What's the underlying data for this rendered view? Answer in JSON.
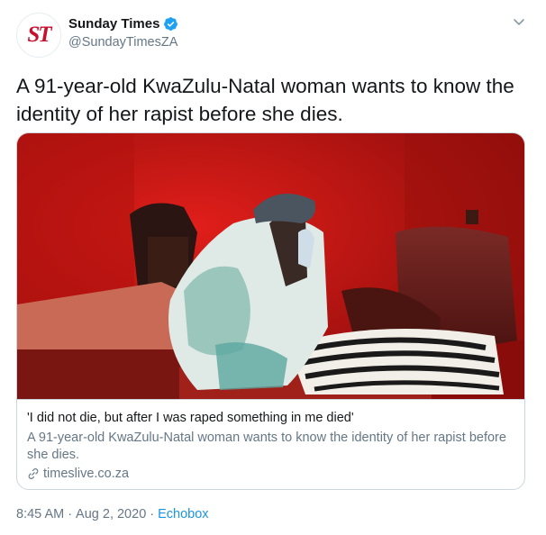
{
  "author": {
    "avatar_text": "ST",
    "display_name": "Sunday Times",
    "handle": "@SundayTimesZA",
    "verified": true
  },
  "tweet": {
    "text": "A 91-year-old KwaZulu-Natal woman wants to know the identity of her rapist before she dies."
  },
  "card": {
    "title": "'I did not die, but after I was raped something in me died'",
    "description": "A 91-year-old KwaZulu-Natal woman wants to know the identity of her rapist before she dies.",
    "domain": "timeslive.co.za"
  },
  "meta": {
    "time": "8:45 AM",
    "separator_1": "·",
    "date": "Aug 2, 2020",
    "separator_2": "·",
    "source": "Echobox"
  },
  "icons": {
    "verified": "verified-badge-icon",
    "menu": "chevron-down-icon",
    "link": "link-icon"
  },
  "colors": {
    "brand_red": "#c8102e",
    "link_blue": "#1b95e0",
    "verified_blue": "#1da1f2",
    "secondary_text": "#657786",
    "border": "#ccd6dd"
  }
}
